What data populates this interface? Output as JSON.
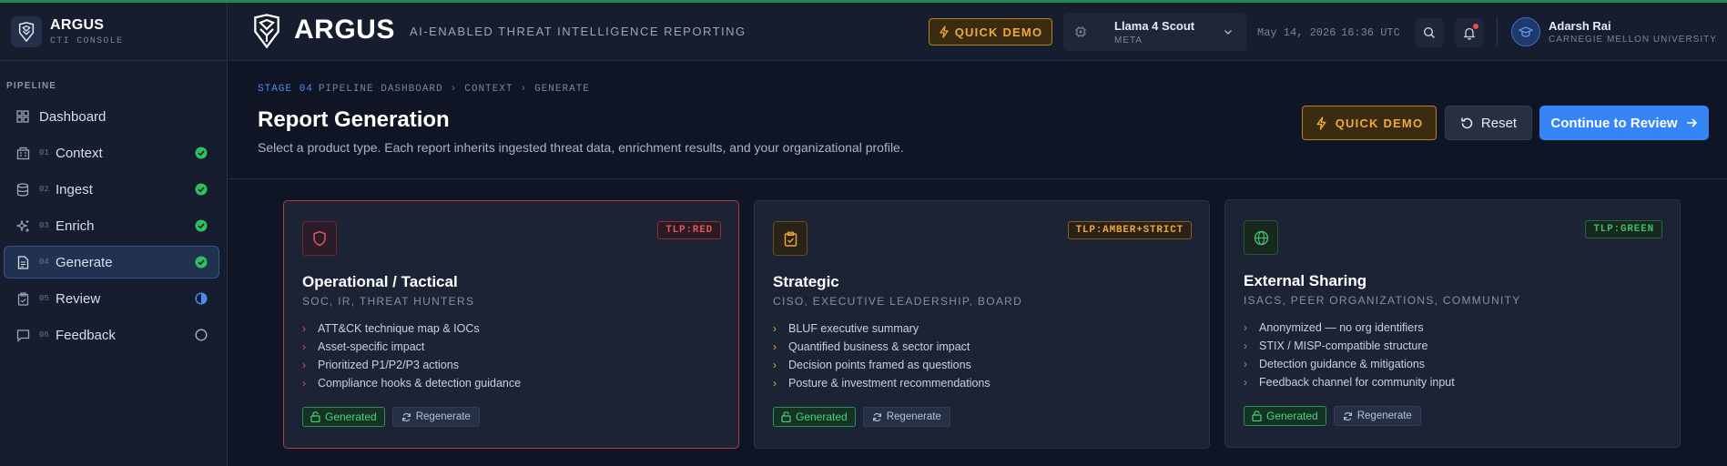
{
  "sidebar": {
    "brand_name": "ARGUS",
    "brand_sub": "CTI CONSOLE",
    "section_label": "PIPELINE",
    "items": [
      {
        "num": "",
        "label": "Dashboard",
        "status": "none"
      },
      {
        "num": "01",
        "label": "Context",
        "status": "done"
      },
      {
        "num": "02",
        "label": "Ingest",
        "status": "done"
      },
      {
        "num": "03",
        "label": "Enrich",
        "status": "done"
      },
      {
        "num": "04",
        "label": "Generate",
        "status": "done"
      },
      {
        "num": "05",
        "label": "Review",
        "status": "partial"
      },
      {
        "num": "06",
        "label": "Feedback",
        "status": "pending"
      }
    ]
  },
  "header": {
    "title": "ARGUS",
    "tagline": "AI-ENABLED THREAT INTELLIGENCE REPORTING",
    "quick_demo": "QUICK DEMO",
    "model_name": "Llama 4 Scout",
    "model_vendor": "META",
    "date": "May 14, 2026",
    "time": "16:36 UTC",
    "user_name": "Adarsh Rai",
    "user_org": "CARNEGIE MELLON UNIVERSITY"
  },
  "page": {
    "crumb_stage": "STAGE 04",
    "crumb_1": "PIPELINE DASHBOARD",
    "crumb_2": "CONTEXT",
    "crumb_3": "GENERATE",
    "title": "Report Generation",
    "description": "Select a product type. Each report inherits ingested threat data, enrichment results, and your organizational profile.",
    "quick_demo": "QUICK DEMO",
    "reset": "Reset",
    "continue": "Continue to Review"
  },
  "cards": [
    {
      "title": "Operational / Tactical",
      "audience": "SOC, IR, THREAT HUNTERS",
      "tlp": "TLP:RED",
      "bullets": [
        "ATT&CK technique map & IOCs",
        "Asset-specific impact",
        "Prioritized P1/P2/P3 actions",
        "Compliance hooks & detection guidance"
      ],
      "status": "Generated",
      "regen": "Regenerate"
    },
    {
      "title": "Strategic",
      "audience": "CISO, EXECUTIVE LEADERSHIP, BOARD",
      "tlp": "TLP:AMBER+STRICT",
      "bullets": [
        "BLUF executive summary",
        "Quantified business & sector impact",
        "Decision points framed as questions",
        "Posture & investment recommendations"
      ],
      "status": "Generated",
      "regen": "Regenerate"
    },
    {
      "title": "External Sharing",
      "audience": "ISACS, PEER ORGANIZATIONS, COMMUNITY",
      "tlp": "TLP:GREEN",
      "bullets": [
        "Anonymized — no org identifiers",
        "STIX / MISP-compatible structure",
        "Detection guidance & mitigations",
        "Feedback channel for community input"
      ],
      "status": "Generated",
      "regen": "Regenerate"
    }
  ],
  "colors": {
    "accent": "#3585f5",
    "demo": "#f2a73b",
    "success": "#4ed17f",
    "tlp_red": "#e25561",
    "tlp_amber": "#f0a43a",
    "tlp_green": "#3fbf6c"
  }
}
